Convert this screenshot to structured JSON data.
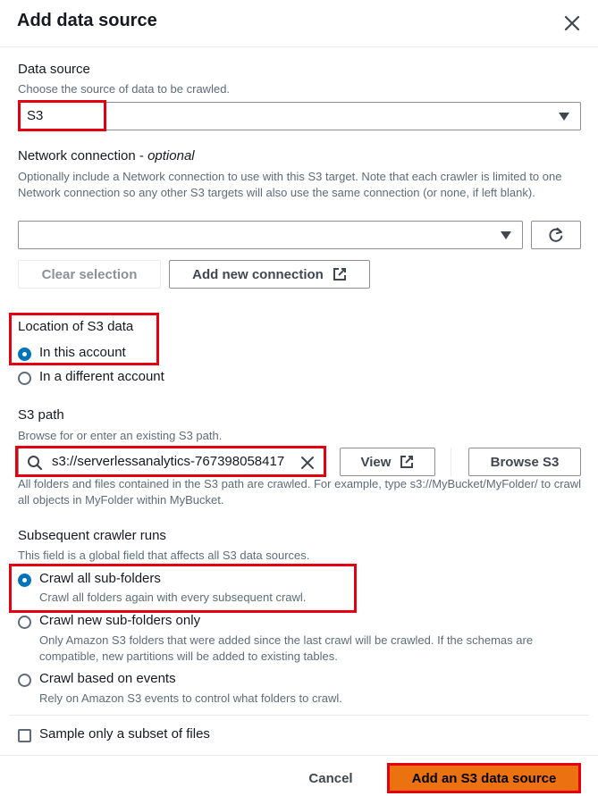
{
  "dialog": {
    "title": "Add data source"
  },
  "data_source": {
    "label": "Data source",
    "description": "Choose the source of data to be crawled.",
    "selected": "S3"
  },
  "network": {
    "label": "Network connection",
    "optional": "optional",
    "label_sep": " - ",
    "description": "Optionally include a Network connection to use with this S3 target. Note that each crawler is limited to one Network connection so any other S3 targets will also use the same connection (or none, if left blank).",
    "selected": "",
    "clear_label": "Clear selection",
    "add_label": "Add new connection"
  },
  "location": {
    "label": "Location of S3 data",
    "options": [
      "In this account",
      "In a different account"
    ],
    "selected_index": 0
  },
  "s3_path": {
    "label": "S3 path",
    "description": "Browse for or enter an existing S3 path.",
    "value": "s3://serverlessanalytics-767398058417",
    "view_label": "View",
    "browse_label": "Browse S3",
    "hint": "All folders and files contained in the S3 path are crawled. For example, type s3://MyBucket/MyFolder/ to crawl all objects in MyFolder within MyBucket."
  },
  "subsequent": {
    "label": "Subsequent crawler runs",
    "description": "This field is a global field that affects all S3 data sources.",
    "options": [
      {
        "label": "Crawl all sub-folders",
        "description": "Crawl all folders again with every subsequent crawl."
      },
      {
        "label": "Crawl new sub-folders only",
        "description": "Only Amazon S3 folders that were added since the last crawl will be crawled. If the schemas are compatible, new partitions will be added to existing tables."
      },
      {
        "label": "Crawl based on events",
        "description": "Rely on Amazon S3 events to control what folders to crawl."
      }
    ],
    "selected_index": 0
  },
  "sample": {
    "label": "Sample only a subset of files",
    "checked": false
  },
  "footer": {
    "cancel_label": "Cancel",
    "primary_label": "Add an S3 data source"
  },
  "colors": {
    "accent": "#0073bb",
    "primary_button": "#ec7211",
    "highlight": "#e3000f"
  }
}
